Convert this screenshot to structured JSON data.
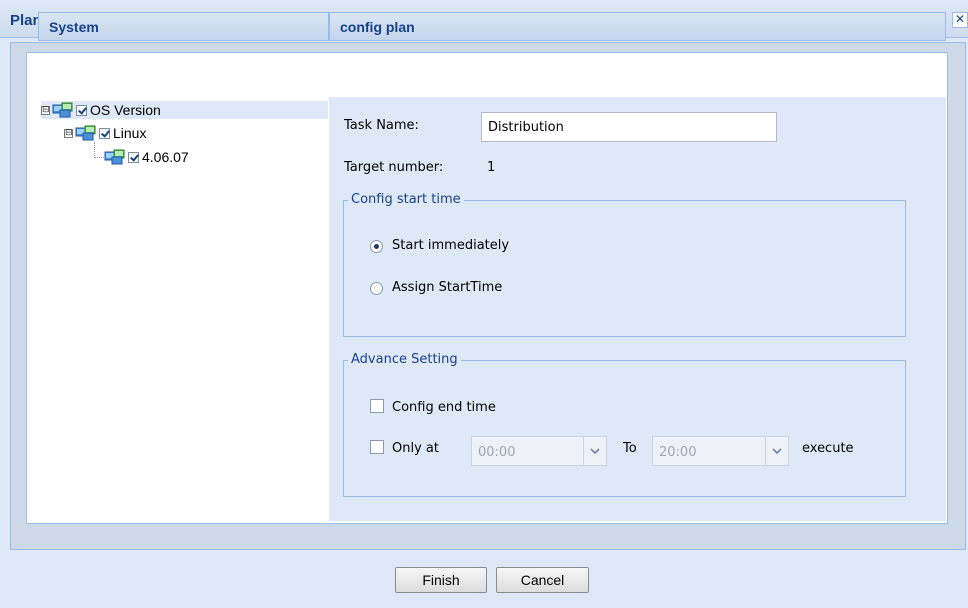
{
  "window": {
    "title": "Plan Wizard",
    "close_glyph": "✕"
  },
  "system_panel": {
    "header": "System",
    "tree": [
      {
        "label": "OS Version",
        "expander": "⊟",
        "checked": true,
        "selected": true
      },
      {
        "label": "Linux",
        "expander": "⊟",
        "checked": true
      },
      {
        "label": "4.06.07",
        "checked": true
      }
    ]
  },
  "config_panel": {
    "header": "config plan",
    "task_name_label": "Task Name:",
    "task_name_value": "Distribution",
    "target_number_label": "Target number:",
    "target_number_value": "1",
    "start_time": {
      "legend": "Config start time",
      "options": [
        {
          "label": "Start immediately",
          "selected": true
        },
        {
          "label": "Assign StartTime",
          "selected": false
        }
      ]
    },
    "advance": {
      "legend": "Advance Setting",
      "config_end_time_label": "Config end time",
      "only_at_label": "Only at",
      "from_time": "00:00",
      "to_label": "To",
      "to_time": "20:00",
      "execute_label": "execute"
    }
  },
  "footer": {
    "finish_label": "Finish",
    "cancel_label": "Cancel"
  },
  "colors": {
    "accent": "#15428b",
    "border": "#99bbe8",
    "panel": "#dfe8f6"
  }
}
